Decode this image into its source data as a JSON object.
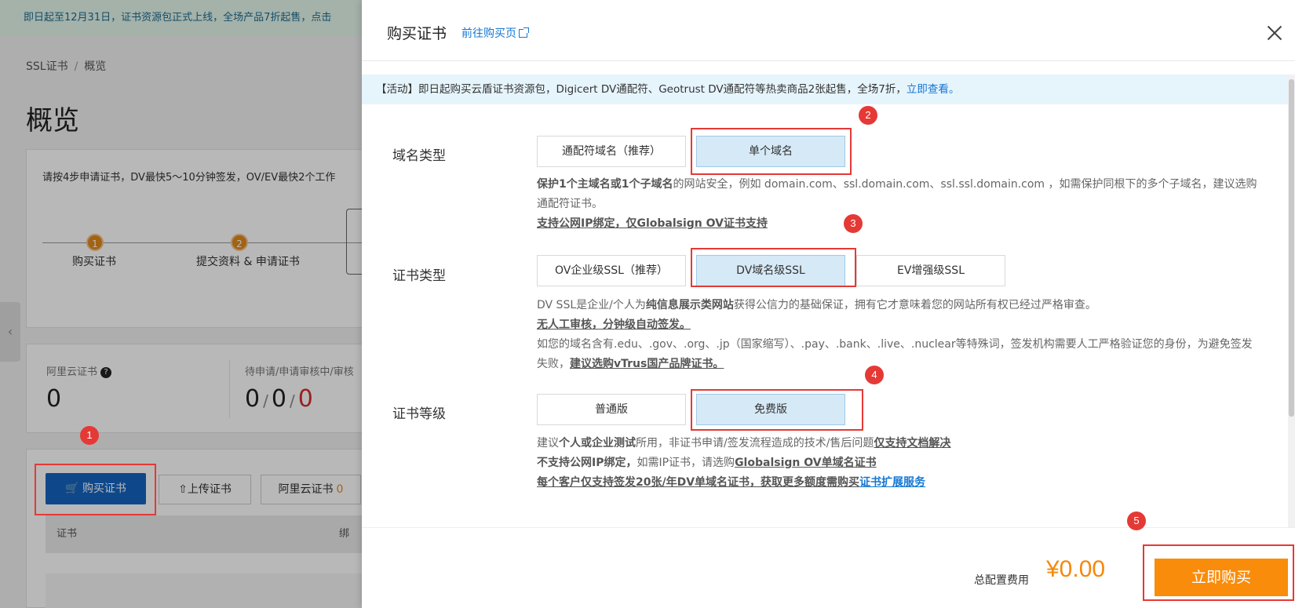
{
  "banner": {
    "text": "即日起至12月31日，证书资源包正式上线，全场产品7折起售，点击"
  },
  "breadcrumb": {
    "root": "SSL证书",
    "sep": "/",
    "current": "概览"
  },
  "page": {
    "title": "概览"
  },
  "steps": {
    "tip": "请按4步申请证书，DV最快5～10分钟签发，OV/EV最快2个工作",
    "items": [
      {
        "num": "1",
        "label": "购买证书"
      },
      {
        "num": "2",
        "label": "提交资料 & 申请证书"
      }
    ]
  },
  "stats": {
    "aliyun_label": "阿里云证书",
    "aliyun_help": "?",
    "aliyun_value": "0",
    "pending_label": "待申请/申请审核中/审核",
    "pending_a": "0",
    "slash1": "/",
    "pending_b": "0",
    "slash2": "/",
    "pending_c": "0"
  },
  "list": {
    "buy_button": "购买证书",
    "upload_button": "上传证书",
    "aliyun_button": "阿里云证书",
    "aliyun_count": "0",
    "col_cert": "证书",
    "col_bind": "绑"
  },
  "side_tab": {
    "icon": "‹"
  },
  "drawer": {
    "title": "购买证书",
    "link": "前往购买页",
    "promo_text": "【活动】即日起购买云盾证书资源包，Digicert DV通配符、Geotrust DV通配符等热卖商品2张起售，全场7折，",
    "promo_link": "立即查看。",
    "domain_type": {
      "label": "域名类型",
      "options": [
        "通配符域名（推荐）",
        "单个域名"
      ],
      "selected": "单个域名",
      "desc_bold": "保护1个主域名或1个子域名",
      "desc_text": "的网站安全，例如 domain.com、ssl.domain.com、ssl.ssl.domain.com ，如需保护同根下的多个子域名，建议选购通配符证书。",
      "desc_note": "支持公网IP绑定，仅Globalsign OV证书支持"
    },
    "cert_type": {
      "label": "证书类型",
      "options": [
        "OV企业级SSL（推荐）",
        "DV域名级SSL",
        "EV增强级SSL"
      ],
      "selected": "DV域名级SSL",
      "desc_1a": "DV SSL是企业/个人为",
      "desc_1b": "纯信息展示类网站",
      "desc_1c": "获得公信力的基础保证，拥有它才意味着您的网站所有权已经过严格审查。",
      "desc_2": "无人工审核，分钟级自动签发。",
      "desc_3": "如您的域名含有.edu、.gov、.org、.jp（国家缩写）、.pay、.bank、.live、.nuclear等特殊词，签发机构需要人工严格验证您的身份，为避免签发失败，",
      "desc_3_link": "建议选购vTrus国产品牌证书。"
    },
    "cert_level": {
      "label": "证书等级",
      "options": [
        "普通版",
        "免费版"
      ],
      "selected": "免费版",
      "desc_1a": "建议",
      "desc_1b": "个人或企业测试",
      "desc_1c": "所用，非证书申请/签发流程造成的技术/售后问题",
      "desc_1d": "仅支持文档解决",
      "desc_2a": "不支持公网IP绑定，",
      "desc_2b": "如需IP证书，请选购",
      "desc_2c": "Globalsign OV单域名证书",
      "desc_3a": "每个客户仅支持签发20张/年DV单域名证书，获取更多额度需购买",
      "desc_3b": "证书扩展服务"
    },
    "footer": {
      "fee_label": "总配置费用",
      "fee_value": "¥0.00",
      "buy_button": "立即购买"
    }
  },
  "annotations": [
    "1",
    "2",
    "3",
    "4",
    "5"
  ],
  "colors": {
    "accent": "#fa8c0b",
    "primary": "#1565c0",
    "link": "#1677d2",
    "annotation": "#e53935"
  }
}
